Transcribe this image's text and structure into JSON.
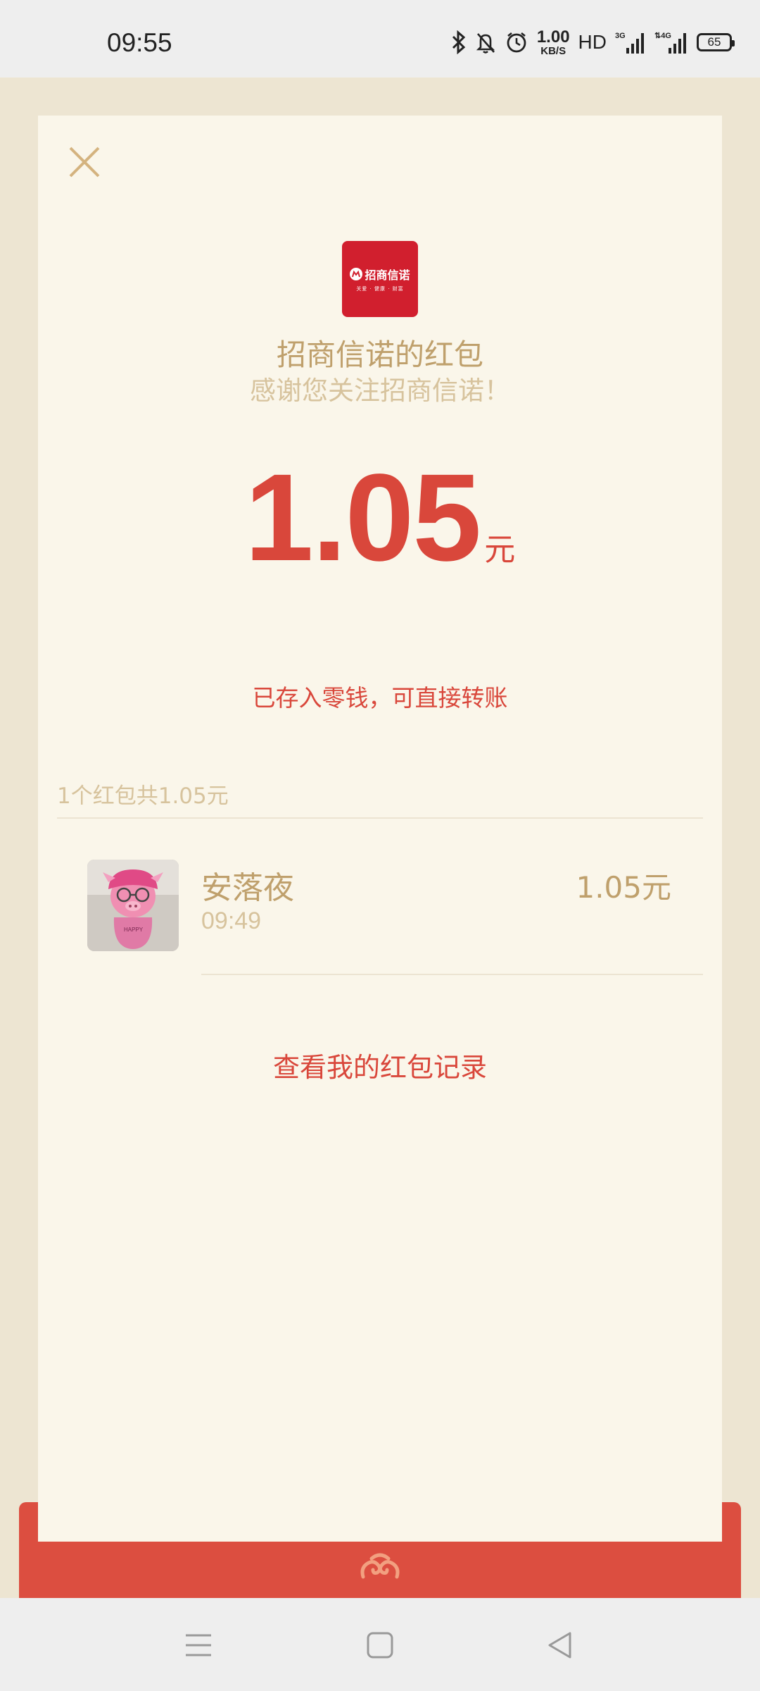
{
  "status_bar": {
    "time": "09:55",
    "net_speed_value": "1.00",
    "net_speed_unit": "KB/S",
    "hd_label": "HD",
    "signal_1": "3G",
    "signal_2": "4G",
    "battery": "65"
  },
  "packet": {
    "sender_title": "招商信诺的红包",
    "blessing": "感谢您关注招商信诺！",
    "logo_text": "招商信诺",
    "logo_subtext": "关爱 · 健康 · 财富",
    "amount": "1.05",
    "amount_unit": "元",
    "deposit_note": "已存入零钱，可直接转账",
    "summary": "1个红包共1.05元",
    "records": [
      {
        "name": "安落夜",
        "time": "09:49",
        "amount": "1.05元"
      }
    ],
    "view_records_label": "查看我的红包记录"
  },
  "colors": {
    "accent_red": "#d9473b",
    "gold": "#bfa06c",
    "gold_light": "#d7c39d",
    "card_bg": "#faf6ea",
    "outer_bg": "#ede5d2"
  }
}
